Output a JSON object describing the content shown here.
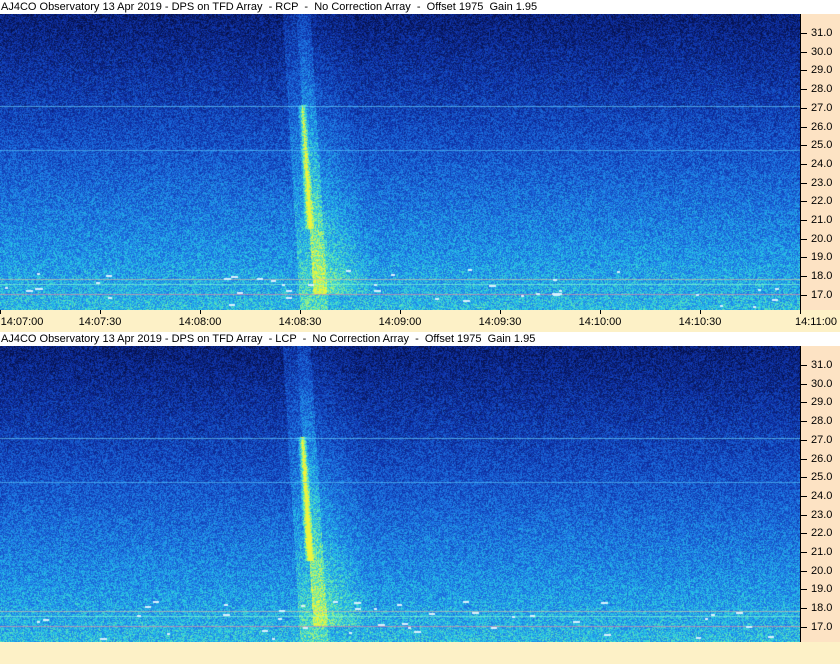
{
  "panels": [
    {
      "title": "AJ4CO Observatory 13 Apr 2019 - DPS on TFD Array  - RCP  -  No Correction Array  -  Offset 1975  Gain 1.95",
      "polarization": "RCP",
      "freq_ticks": [
        "31.0",
        "30.0",
        "29.0",
        "28.0",
        "27.0",
        "26.0",
        "25.0",
        "24.0",
        "23.0",
        "22.0",
        "21.0",
        "20.0",
        "19.0",
        "18.0",
        "17.0"
      ]
    },
    {
      "title": "AJ4CO Observatory 13 Apr 2019 - DPS on TFD Array  - LCP  -  No Correction Array  -  Offset 1975  Gain 1.95",
      "polarization": "LCP",
      "freq_ticks": [
        "31.0",
        "30.0",
        "29.0",
        "28.0",
        "27.0",
        "26.0",
        "25.0",
        "24.0",
        "23.0",
        "22.0",
        "21.0",
        "20.0",
        "19.0",
        "18.0",
        "17.0"
      ]
    }
  ],
  "time_axis": {
    "labels": [
      "14:07:00",
      "14:07:30",
      "14:08:00",
      "14:08:30",
      "14:09:00",
      "14:09:30",
      "14:10:00",
      "14:10:30",
      "14:11:00"
    ]
  },
  "colors": {
    "axis_bg": "#fde3c4",
    "time_axis_bg": "#fdf1c7",
    "spectrogram_low": "#0a1f6e",
    "spectrogram_high": "#3fe0d0",
    "burst": "#e8f040"
  }
}
